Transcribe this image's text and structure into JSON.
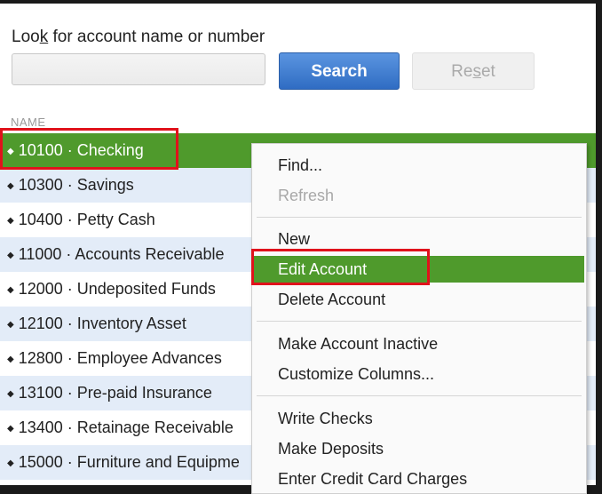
{
  "search": {
    "label_prefix": "Loo",
    "label_underlined": "k",
    "label_suffix": " for account name or number",
    "search_button": "Search",
    "reset_prefix": "Re",
    "reset_underlined": "s",
    "reset_suffix": "et"
  },
  "list": {
    "column_header": "NAME",
    "rows": [
      {
        "label": "10100 · Checking"
      },
      {
        "label": "10300 · Savings"
      },
      {
        "label": "10400 · Petty Cash"
      },
      {
        "label": "11000 · Accounts Receivable"
      },
      {
        "label": "12000 · Undeposited Funds"
      },
      {
        "label": "12100 · Inventory Asset"
      },
      {
        "label": "12800 · Employee Advances"
      },
      {
        "label": "13100 · Pre-paid Insurance"
      },
      {
        "label": "13400 · Retainage Receivable"
      },
      {
        "label": "15000 · Furniture and Equipme"
      }
    ]
  },
  "context_menu": {
    "items": [
      {
        "label": "Find..."
      },
      {
        "label": "Refresh"
      },
      {
        "label": "New"
      },
      {
        "label": "Edit Account"
      },
      {
        "label": "Delete Account"
      },
      {
        "label": "Make Account Inactive"
      },
      {
        "label": "Customize Columns..."
      },
      {
        "label": "Write Checks"
      },
      {
        "label": "Make Deposits"
      },
      {
        "label": "Enter Credit Card Charges"
      }
    ]
  },
  "colors": {
    "selection_green": "#4f9a2c",
    "alt_row_blue": "#e3ecf8",
    "highlight_red": "#e0121b",
    "search_button_blue": "#2f6cc3"
  }
}
